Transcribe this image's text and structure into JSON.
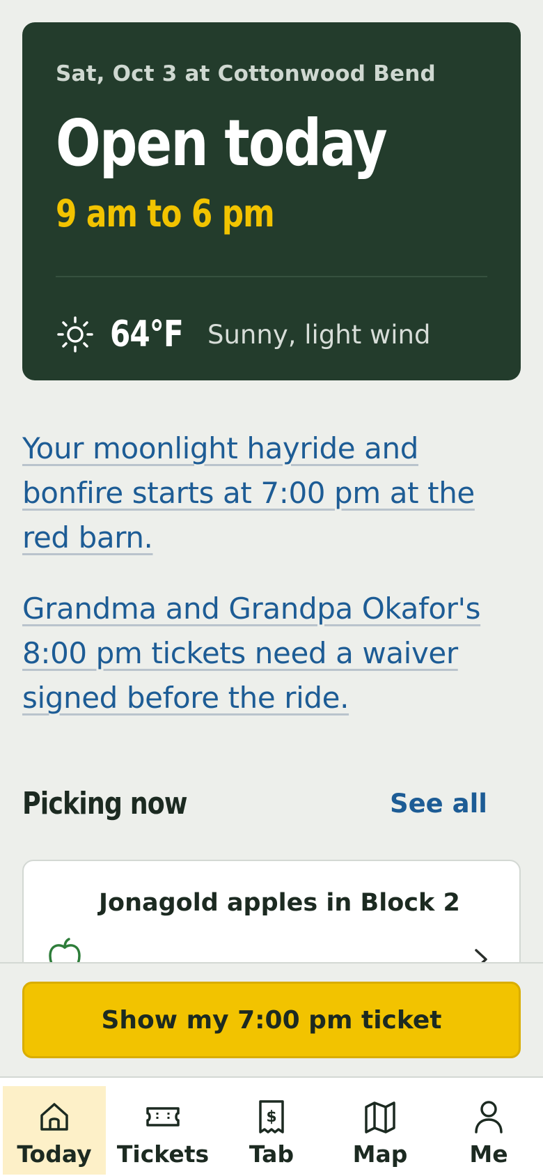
{
  "hero": {
    "date_location": "Sat, Oct 3 at Cottonwood Bend",
    "status": "Open today",
    "hours": "9 am to 6 pm",
    "weather": {
      "icon": "sun-icon",
      "temperature": "64°F",
      "conditions": "Sunny, light wind"
    },
    "colors": {
      "background": "#233c2c",
      "hours": "#f2c300"
    }
  },
  "alerts": [
    {
      "text": "Your moonlight hayride and bonfire starts at 7:00 pm at the red barn."
    },
    {
      "text": "Grandma and Grandpa Okafor's 8:00 pm tickets need a waiver signed before the ride."
    }
  ],
  "picking": {
    "title": "Picking now",
    "see_all": "See all",
    "items": [
      {
        "icon": "apple-icon",
        "label": "Jonagold apples in Block 2"
      }
    ]
  },
  "cta": {
    "label": "Show my 7:00 pm ticket",
    "color": "#f2c300"
  },
  "nav": {
    "active": "Today",
    "items": [
      {
        "label": "Today",
        "icon": "home-icon"
      },
      {
        "label": "Tickets",
        "icon": "ticket-icon"
      },
      {
        "label": "Tab",
        "icon": "receipt-dollar-icon"
      },
      {
        "label": "Map",
        "icon": "map-icon"
      },
      {
        "label": "Me",
        "icon": "person-icon"
      }
    ]
  }
}
